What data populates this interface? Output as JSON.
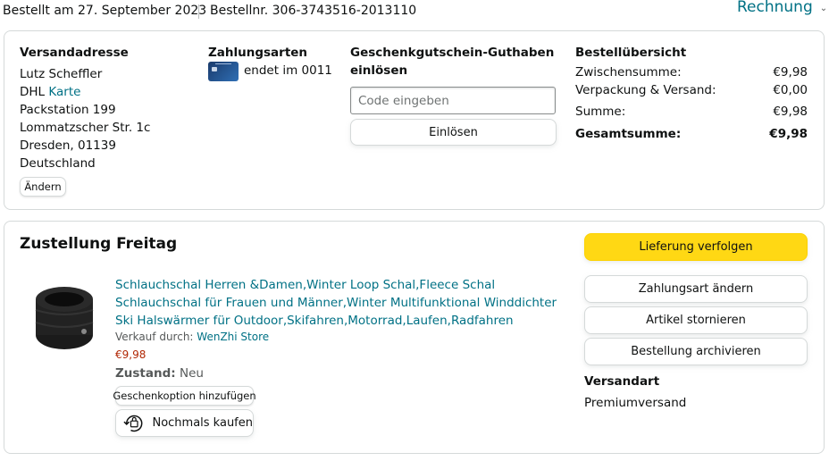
{
  "header": {
    "order_date": "Bestellt am 27. September 2023",
    "order_number": "Bestellnr. 306-3743516-2013110",
    "invoice_label": "Rechnung",
    "invoice_chevron": "⌄"
  },
  "shipping_address": {
    "heading": "Versandadresse",
    "name": "Lutz Scheffler",
    "carrier": "DHL",
    "carrier_link": "Karte",
    "line1": "Packstation 199",
    "line2": "Lommatzscher Str. 1c",
    "city": "Dresden, 01139",
    "country": "Deutschland",
    "change_label": "Ändern"
  },
  "payment": {
    "heading": "Zahlungsarten",
    "card_text": "endet im 0011",
    "card_icon": "credit-card-icon"
  },
  "gift_card": {
    "heading_line1": "Geschenkgutschein-Guthaben",
    "heading_line2": "einlösen",
    "placeholder": "Code eingeben",
    "redeem_label": "Einlösen"
  },
  "summary": {
    "heading": "Bestellübersicht",
    "rows": [
      {
        "label": "Zwischensumme:",
        "value": "€9,98"
      },
      {
        "label": "Verpackung & Versand:",
        "value": "€0,00"
      },
      {
        "label": "Summe:",
        "value": "€9,98"
      },
      {
        "label": "Gesamtsumme:",
        "value": "€9,98"
      }
    ]
  },
  "delivery": {
    "heading": "Zustellung Freitag",
    "product": {
      "title": "Schlauchschal Herren &Damen,Winter Loop Schal,Fleece Schal Schlauchschal für Frauen und Männer,Winter Multifunktional Winddichter Ski Halswärmer für Outdoor,Skifahren,Motorrad,Laufen,Radfahren",
      "seller_prefix": "Verkauf durch:",
      "seller": "WenZhi Store",
      "price": "€9,98",
      "condition_label": "Zustand:",
      "condition": "Neu",
      "gift_option_label": "Geschenkoption hinzufügen",
      "buy_again_label": "Nochmals kaufen"
    },
    "actions": {
      "track": "Lieferung verfolgen",
      "change_payment": "Zahlungsart ändern",
      "cancel": "Artikel stornieren",
      "archive": "Bestellung archivieren"
    },
    "shipping_type_heading": "Versandart",
    "shipping_type": "Premiumversand"
  },
  "colors": {
    "link": "#007185",
    "primary_button": "#ffd814",
    "price": "#b12704",
    "border": "#d5d9d9"
  }
}
